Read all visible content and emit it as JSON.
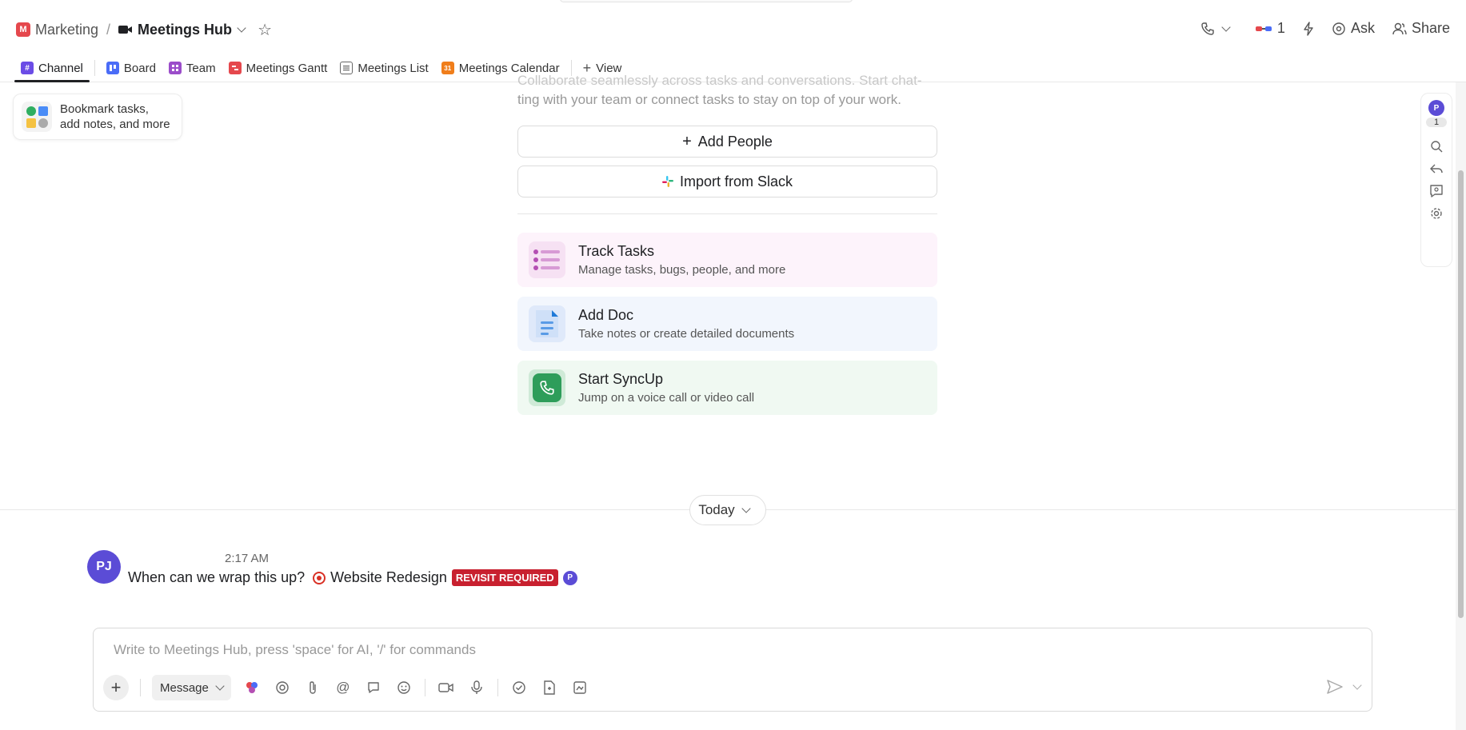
{
  "breadcrumb": {
    "space_badge": "M",
    "space_name": "Marketing",
    "separator": "/",
    "current": "Meetings Hub"
  },
  "header_right": {
    "ai_count": "1",
    "ask_label": "Ask",
    "share_label": "Share"
  },
  "tabs": [
    {
      "label": "Channel",
      "icon": "hash-icon",
      "color": "#6b4ce6"
    },
    {
      "label": "Board",
      "icon": "board-icon",
      "color": "#4a6cf7"
    },
    {
      "label": "Team",
      "icon": "team-icon",
      "color": "#9b4dca"
    },
    {
      "label": "Meetings Gantt",
      "icon": "gantt-icon",
      "color": "#e5484d"
    },
    {
      "label": "Meetings List",
      "icon": "list-icon",
      "color": "#666666"
    },
    {
      "label": "Meetings Calendar",
      "icon": "calendar-icon",
      "color": "#f07e1b"
    }
  ],
  "add_view_label": "View",
  "bookmark": {
    "line1": "Bookmark tasks,",
    "line2": "add notes, and more"
  },
  "intro": {
    "line1": "Collaborate seamlessly across tasks and conversations. Start chat-",
    "line2": "ting with your team or connect tasks to stay on top of your work."
  },
  "actions": {
    "add_people": "Add People",
    "import_slack": "Import from Slack"
  },
  "cards": [
    {
      "title": "Track Tasks",
      "subtitle": "Manage tasks, bugs, people, and more",
      "bg": "#fdf3fb",
      "icon": "list-icon"
    },
    {
      "title": "Add Doc",
      "subtitle": "Take notes or create detailed documents",
      "bg": "#f2f6fd",
      "icon": "doc-icon"
    },
    {
      "title": "Start SyncUp",
      "subtitle": "Jump on a voice call or video call",
      "bg": "#f0f9f2",
      "icon": "phone-icon"
    }
  ],
  "today_label": "Today",
  "message": {
    "avatar_initials": "PJ",
    "time": "2:17 AM",
    "text": "When can we wrap this up?",
    "task_name": "Website Redesign",
    "status": "REVISIT REQUIRED",
    "assignee_initial": "P"
  },
  "composer": {
    "placeholder": "Write to Meetings Hub, press 'space' for AI, '/' for commands",
    "message_type": "Message"
  },
  "rightbar": {
    "avatar_initial": "P",
    "count": "1"
  }
}
